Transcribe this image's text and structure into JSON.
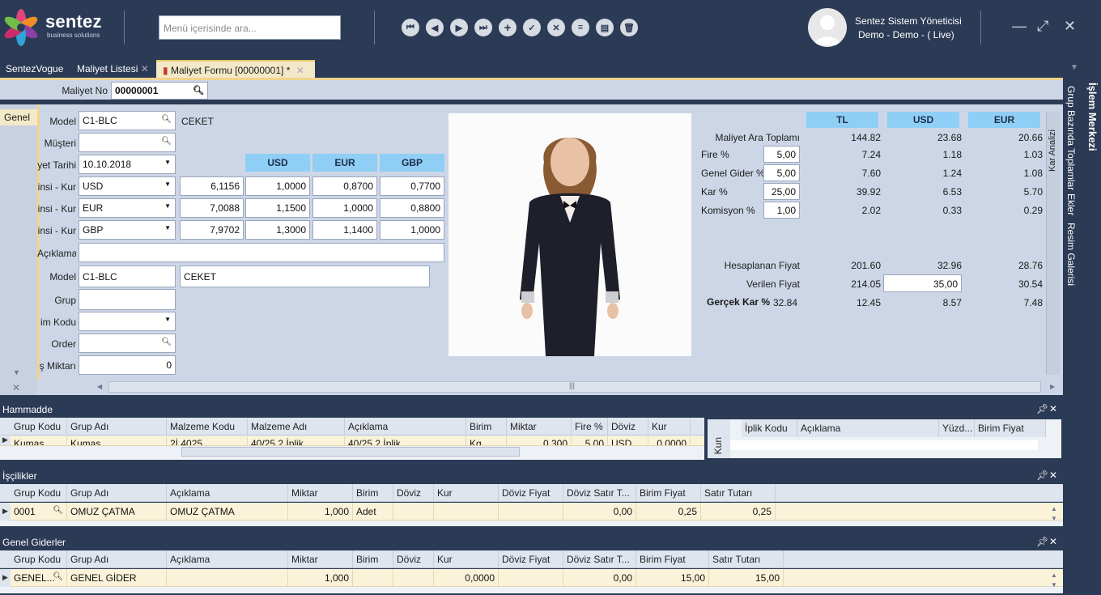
{
  "app": {
    "logo_main": "sentez",
    "logo_sub": "business solutions"
  },
  "search": {
    "placeholder": "Menü içerisinde ara..."
  },
  "user": {
    "name": "Sentez Sistem Yöneticisi",
    "context": "Demo - Demo - ( Live)"
  },
  "tabs": [
    {
      "label": "SentezVogue"
    },
    {
      "label": "Maliyet Listesi"
    },
    {
      "label": "Maliyet Formu [00000001]  *"
    }
  ],
  "header": {
    "maliyet_no_label": "Maliyet No",
    "maliyet_no_value": "00000001"
  },
  "left_tab": {
    "label": "Genel"
  },
  "form": {
    "model_label": "Model",
    "model_value": "C1-BLC",
    "model_desc": "CEKET",
    "musteri_label": "Müşteri",
    "musteri_value": "",
    "tarih_label": "yet Tarihi",
    "tarih_value": "10.10.2018",
    "cur_headers": [
      "USD",
      "EUR",
      "GBP"
    ],
    "kur_rows": [
      {
        "label": "insi - Kur",
        "currency": "USD",
        "rate": "6,1156",
        "usd": "1,0000",
        "eur": "0,8700",
        "gbp": "0,7700"
      },
      {
        "label": "insi - Kur",
        "currency": "EUR",
        "rate": "7,0088",
        "usd": "1,1500",
        "eur": "1,0000",
        "gbp": "0,8800"
      },
      {
        "label": "insi - Kur",
        "currency": "GBP",
        "rate": "7,9702",
        "usd": "1,3000",
        "eur": "1,1400",
        "gbp": "1,0000"
      }
    ],
    "aciklama_label": "Açıklama",
    "aciklama_value": "",
    "model2_label": "Model",
    "model2_value": "C1-BLC",
    "model2_desc": "CEKET",
    "grup_label": "Grup",
    "grup_value": "",
    "kodu_label": "im Kodu",
    "kodu_value": "",
    "order_label": "Order",
    "order_value": "",
    "miktar_label": "ş Miktarı",
    "miktar_value": "0"
  },
  "cost": {
    "headers": [
      "TL",
      "USD",
      "EUR"
    ],
    "rows": [
      {
        "label": "Maliyet Ara Toplamı",
        "input": "",
        "tl": "144.82",
        "usd": "23.68",
        "eur": "20.66"
      },
      {
        "label": "Fire %",
        "input": "5,00",
        "tl": "7.24",
        "usd": "1.18",
        "eur": "1.03"
      },
      {
        "label": "Genel Gider %",
        "input": "5,00",
        "tl": "7.60",
        "usd": "1.24",
        "eur": "1.08"
      },
      {
        "label": "Kar %",
        "input": "25,00",
        "tl": "39.92",
        "usd": "6.53",
        "eur": "5.70"
      },
      {
        "label": "Komisyon %",
        "input": "1,00",
        "tl": "2.02",
        "usd": "0.33",
        "eur": "0.29"
      }
    ],
    "hesaplanan": {
      "label": "Hesaplanan Fiyat",
      "tl": "201.60",
      "usd": "32.96",
      "eur": "28.76"
    },
    "verilen": {
      "label": "Verilen Fiyat",
      "tl": "214.05",
      "usd": "35,00",
      "eur": "30.54"
    },
    "gercek": {
      "label": "Gerçek Kar %",
      "value": "32.84",
      "tl": "12.45",
      "usd": "8.57",
      "eur": "7.48"
    },
    "side_label": "Kar Analizi"
  },
  "right_tabs": [
    "İşlem Merkezi",
    "Grup Bazında Toplamlar",
    "Ekler",
    "Resim Galerisi"
  ],
  "hammadde": {
    "title": "Hammadde",
    "columns": [
      "Grup Kodu",
      "Grup Adı",
      "Malzeme Kodu",
      "Malzeme Adı",
      "Açıklama",
      "Birim",
      "Miktar",
      "Fire %",
      "Döviz",
      "Kur"
    ],
    "row": [
      "Kumaş",
      "Kumaş",
      "2İ.4025",
      "40/25 2 İplik",
      "40/25 2 İplik",
      "Kg",
      "0,300",
      "5,00",
      "USD",
      "0,0000"
    ],
    "side_columns": [
      "İplik Kodu",
      "Açıklama",
      "Yüzd...",
      "Birim Fiyat"
    ],
    "side_label": "Kun"
  },
  "iscilik": {
    "title": "İşçilikler",
    "columns": [
      "Grup Kodu",
      "Grup Adı",
      "Açıklama",
      "Miktar",
      "Birim",
      "Döviz",
      "Kur",
      "Döviz Fiyat",
      "Döviz Satır T...",
      "Birim Fiyat",
      "Satır Tutarı"
    ],
    "row": [
      "0001",
      "OMUZ ÇATMA",
      "OMUZ ÇATMA",
      "1,000",
      "Adet",
      "",
      "",
      "",
      "0,00",
      "0,25",
      "0,25"
    ]
  },
  "genel": {
    "title": "Genel Giderler",
    "columns": [
      "Grup Kodu",
      "Grup Adı",
      "Açıklama",
      "Miktar",
      "Birim",
      "Döviz",
      "Kur",
      "Döviz Fiyat",
      "Döviz Satır T...",
      "Birim Fiyat",
      "Satır Tutarı"
    ],
    "row": [
      "GENEL...",
      "GENEL GİDER",
      "",
      "1,000",
      "",
      "",
      "0,0000",
      "",
      "0,00",
      "15,00",
      "15,00"
    ]
  },
  "colors": {
    "bg": "#2b3a55",
    "form": "#ccd6e6",
    "header_blue": "#8fcef5",
    "row_yellow": "#fbf3d9",
    "accent_gold": "#f0d58c"
  }
}
